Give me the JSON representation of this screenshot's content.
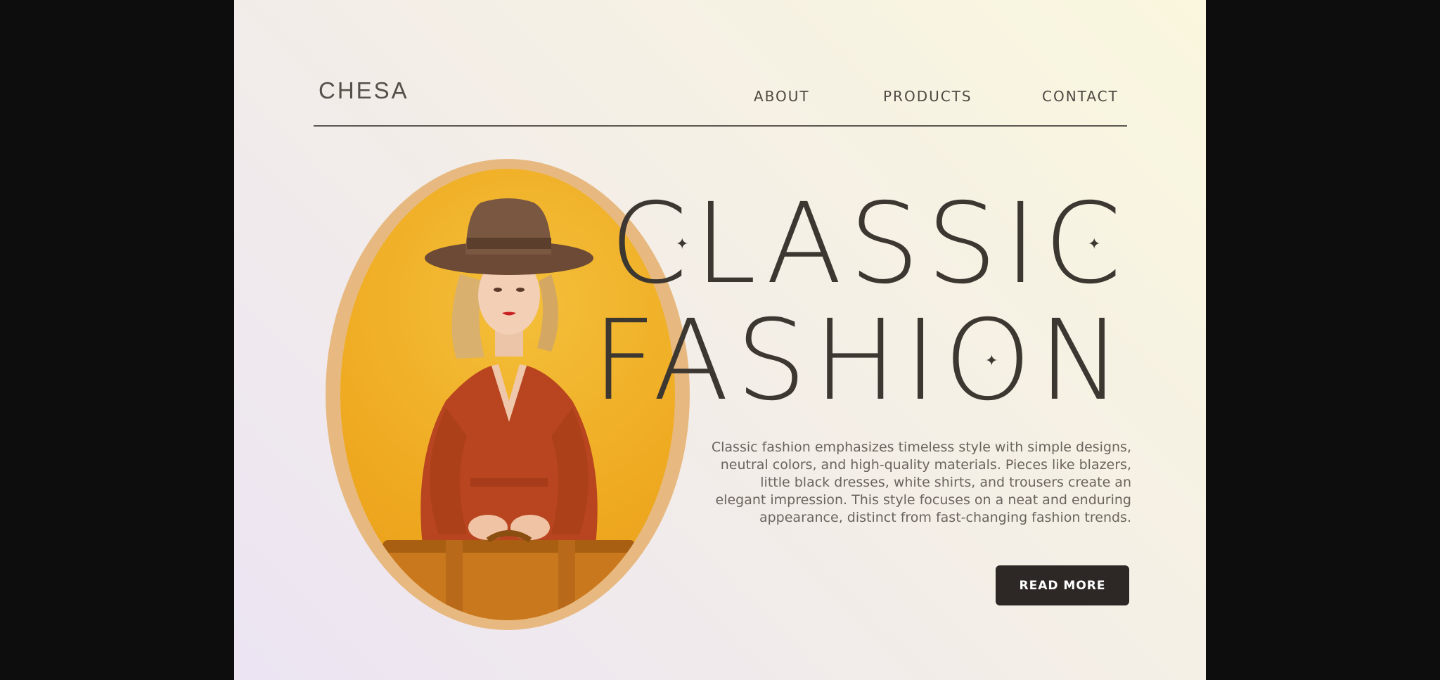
{
  "brand": {
    "name": "CHESA"
  },
  "nav": {
    "about": "ABOUT",
    "products": "PRODUCTS",
    "contact": "CONTACT"
  },
  "hero": {
    "line1": "CLASSIC",
    "line2": "FASHION",
    "description": "Classic fashion emphasizes timeless style with simple designs, neutral colors, and high-quality materials. Pieces like blazers, little black dresses, white shirts, and trousers create an elegant impression. This style focuses on a neat and enduring appearance, distinct from fast-changing fashion trends.",
    "cta_label": "READ MORE"
  },
  "icons": {
    "sparkle": "✦"
  },
  "colors": {
    "accent_dark": "#2d2825",
    "text_dark": "#3d3731",
    "photo_frame": "#e7b980",
    "photo_bg": "#efab22"
  }
}
